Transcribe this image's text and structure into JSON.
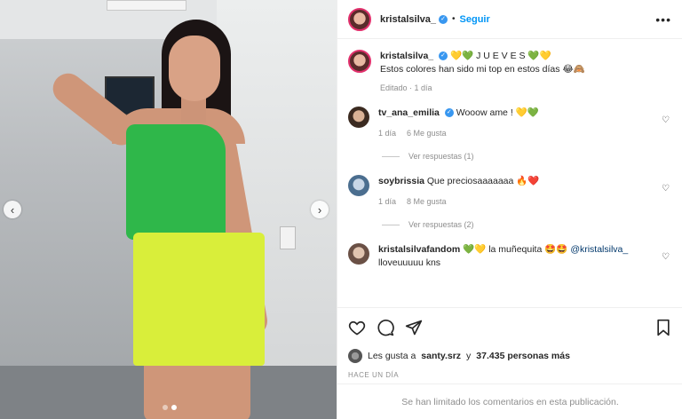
{
  "post": {
    "author": "kristalsilva_",
    "follow_label": "Seguir",
    "more_label": "•••",
    "dot": "•"
  },
  "caption": {
    "username": "kristalsilva_",
    "emoji_prefix": "💛💚",
    "day_word": "J U E V E S",
    "emoji_suffix": "💚💛",
    "text": "Estos colores han sido mi top en estos días 😂🙈",
    "edited": "Editado",
    "time": "1 día"
  },
  "comments": [
    {
      "username": "tv_ana_emilia",
      "verified": true,
      "text": "Wooow ame ! 💛💚",
      "time": "1 día",
      "likes": "6 Me gusta",
      "replies": "Ver respuestas (1)"
    },
    {
      "username": "soybrissia",
      "verified": false,
      "text": "Que preciosaaaaaaa 🔥❤️",
      "time": "1 día",
      "likes": "8 Me gusta",
      "replies": "Ver respuestas (2)"
    },
    {
      "username": "kristalsilvafandom",
      "verified": false,
      "text_before": "💚💛 la muñequita 🤩🤩",
      "mention": "@kristalsilva_",
      "text_after": "lloveuuuuu kns"
    }
  ],
  "likes": {
    "prefix": "Les gusta a",
    "user": "santy.srz",
    "connector": "y",
    "count": "37.435 personas más"
  },
  "date": "HACE UN DÍA",
  "limited_notice": "Se han limitado los comentarios en esta publicación.",
  "carousel": {
    "prev": "‹",
    "next": "›",
    "dots_total": 2,
    "active_dot": 2
  },
  "icons": [
    "heart-icon",
    "comment-icon",
    "share-icon",
    "bookmark-icon"
  ]
}
